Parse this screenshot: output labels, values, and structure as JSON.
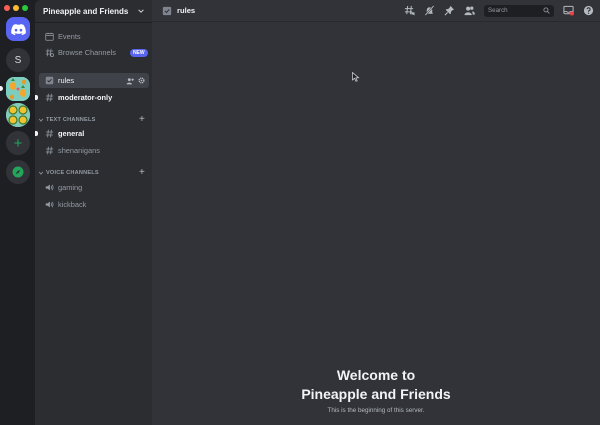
{
  "server": {
    "name": "Pineapple and Friends",
    "rail_letter": "S"
  },
  "sidebar": {
    "top_items": [
      {
        "label": "Events",
        "icon": "calendar-icon"
      },
      {
        "label": "Browse Channels",
        "icon": "browse-channels-icon",
        "badge": "NEW"
      }
    ],
    "pinned_channels": [
      {
        "label": "rules",
        "icon": "rules-icon",
        "active": true
      },
      {
        "label": "moderator-only",
        "icon": "hashtag-icon",
        "unread": true
      }
    ],
    "categories": [
      {
        "label": "TEXT CHANNELS",
        "channels": [
          {
            "label": "general",
            "unread": true
          },
          {
            "label": "shenanigans",
            "unread": false
          }
        ]
      },
      {
        "label": "VOICE CHANNELS",
        "channels": [
          {
            "label": "gaming"
          },
          {
            "label": "kickback"
          }
        ]
      }
    ]
  },
  "header": {
    "channel": "rules",
    "search_placeholder": "Search"
  },
  "welcome": {
    "title_line1": "Welcome to",
    "title_line2": "Pineapple and Friends",
    "subtitle": "This is the beginning of this server."
  },
  "colors": {
    "blurple": "#5865f2",
    "green": "#23a55a",
    "red": "#f23f43"
  }
}
